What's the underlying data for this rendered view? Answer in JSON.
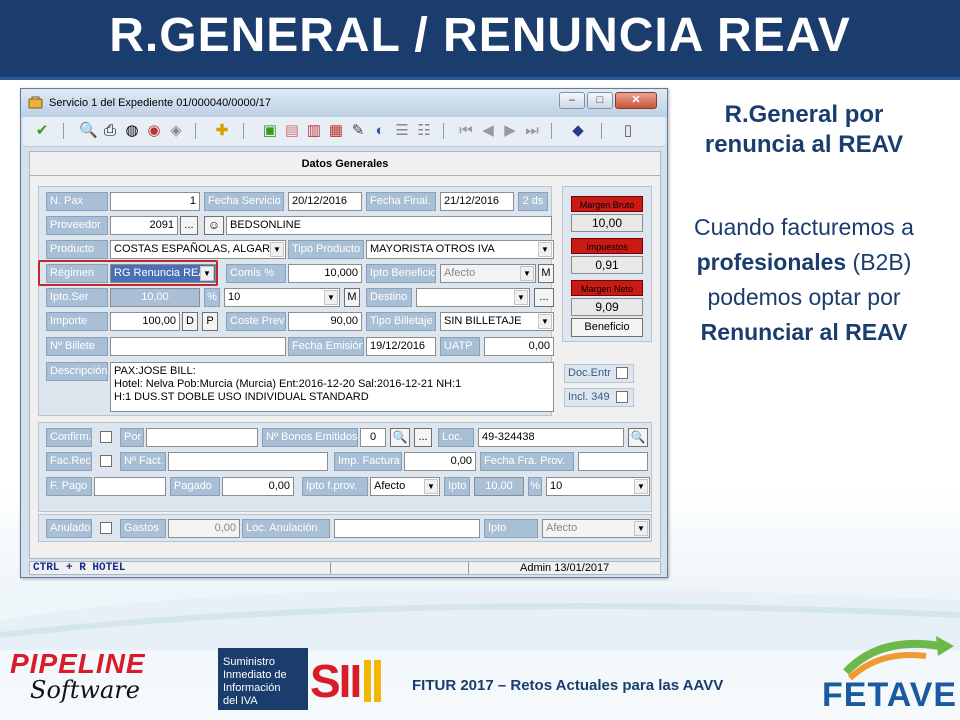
{
  "slide": {
    "title": "R.GENERAL / RENUNCIA REAV"
  },
  "window": {
    "title": "Servicio 1 del Expediente 01/000040/0000/17",
    "min": "‒",
    "max": "□",
    "close": "✕"
  },
  "panel": {
    "title": "Datos Generales"
  },
  "form": {
    "npax_label": "N. Pax",
    "npax": "1",
    "fecha_servicio_label": "Fecha Servicio",
    "fecha_servicio": "20/12/2016",
    "fecha_final_label": "Fecha Final.",
    "fecha_final": "21/12/2016",
    "dias": "2 ds",
    "proveedor_label": "Proveedor",
    "proveedor_code": "2091",
    "proveedor_name": "BEDSONLINE",
    "producto_label": "Producto",
    "producto": "COSTAS ESPAÑOLAS, ALGARV",
    "tipo_producto_label": "Tipo Producto",
    "tipo_producto": "MAYORISTA OTROS IVA",
    "regimen_label": "Régimen",
    "regimen": "RG Renuncia REAV",
    "comis_label": "Comis %",
    "comis": "10,000",
    "ipto_beneficio_label": "Ipto Beneficio",
    "ipto_beneficio": "Afecto",
    "ipto_ser_label": "Ipto.Ser",
    "ipto_ser": "10,00",
    "pct_symbol": "%",
    "ipto_ser_pct": "10",
    "destino_label": "Destino",
    "destino": "",
    "importe_label": "Importe",
    "importe": "100,00",
    "coste_prev_label": "Coste Prev",
    "coste_prev": "90,00",
    "tipo_billetaje_label": "Tipo Billetaje",
    "tipo_billetaje": "SIN BILLETAJE",
    "billete_label": "Nº Billete",
    "billete": "",
    "fecha_emision_label": "Fecha Emisión",
    "fecha_emision": "19/12/2016",
    "uatp_label": "UATP",
    "uatp": "0,00",
    "descripcion_label": "Descripción",
    "descripcion_lines": [
      "PAX:JOSE BILL:",
      "Hotel: Nelva  Pob:Murcia (Murcia)  Ent:2016-12-20  Sal:2016-12-21  NH:1",
      "H:1 DUS.ST DOBLE USO INDIVIDUAL STANDARD"
    ],
    "d_btn": "D",
    "p_btn": "P",
    "m_btn": "M",
    "dots": "...",
    "dd_arrow": "▼"
  },
  "margins": {
    "bruto_label": "Margen Bruto",
    "bruto": "10,00",
    "impuestos_label": "Impuestos",
    "impuestos": "0,91",
    "neto_label": "Margen Neto",
    "neto": "9,09",
    "beneficio_btn": "Beneficio",
    "doc_entr": "Doc.Entr",
    "incl349": "Incl. 349"
  },
  "bottom": {
    "confirm_label": "Confirm.",
    "por_label": "Por",
    "bonos_label": "Nº Bonos Emitidos",
    "bonos": "0",
    "loc_label": "Loc.",
    "loc": "49-324438",
    "facrec_label": "Fac.Rec.",
    "nfact_label": "Nº Fact.",
    "imp_factura_label": "Imp. Factura",
    "imp_factura": "0,00",
    "fecha_fra_label": "Fecha Fra. Prov.",
    "fpago_label": "F. Pago",
    "pagado_label": "Pagado",
    "pagado": "0,00",
    "ipto_fprov_label": "Ipto f.prov.",
    "ipto_fprov": "Afecto",
    "ipto_label": "Ipto",
    "ipto_val": "10,00",
    "ipto_pct": "10",
    "anulado_label": "Anulado",
    "gastos_label": "Gastos",
    "gastos": "0,00",
    "loc_anul_label": "Loc. Anulación",
    "ipto2_label": "Ipto",
    "ipto2": "Afecto"
  },
  "status": {
    "left": "CTRL + R HOTEL",
    "right": "Admin 13/01/2017"
  },
  "side": {
    "heading_line1": "R.General por",
    "heading_line2": "renuncia al REAV",
    "p1": "Cuando facturemos a",
    "p2_bold": "profesionales",
    "p2_rest": " (B2B)",
    "p3": "podemos optar por",
    "p4": "Renunciar al REAV"
  },
  "footer": {
    "pipeline_top": "PIPELINE",
    "pipeline_script": "Software",
    "sii_line1": "Suministro",
    "sii_line2": "Inmediato de",
    "sii_line3": "Información",
    "sii_line4": "del IVA",
    "sii_logo": "SII",
    "fitur": "FITUR 2017 – Retos Actuales para las AAVV",
    "fetave": "FETAVE"
  },
  "colors": {
    "header": "#1a3d6e",
    "label": "#a9bfd6",
    "margin_red": "#c91a14",
    "accent_green": "#6db84b",
    "accent_orange": "#f29a2e"
  }
}
